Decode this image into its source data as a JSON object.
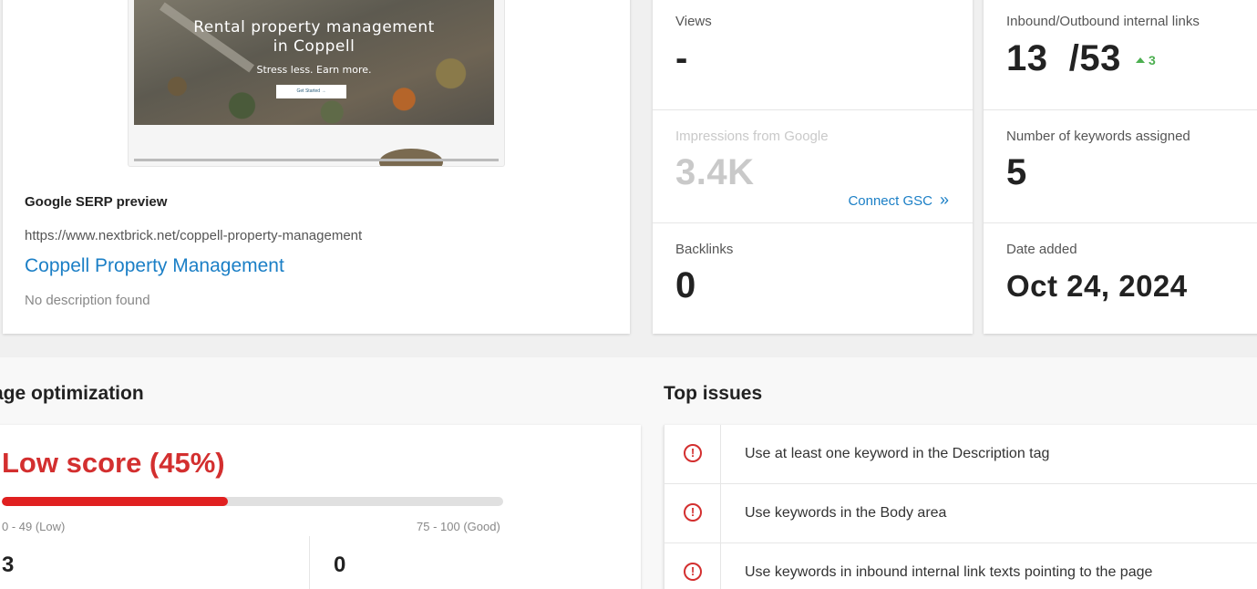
{
  "preview": {
    "thumbnail": {
      "headline": "Rental property management in Coppell",
      "tagline": "Stress less. Earn more.",
      "button_label": "Get Started →"
    },
    "serp_label": "Google SERP preview",
    "url": "https://www.nextbrick.net/coppell-property-management",
    "title": "Coppell Property Management",
    "description": "No description found"
  },
  "metrics": {
    "views": {
      "label": "Views",
      "value": "-"
    },
    "impressions": {
      "label": "Impressions from Google",
      "value": "3.4K",
      "connect_label": "Connect GSC",
      "connect_icon": "double-chevron-right-icon"
    },
    "backlinks": {
      "label": "Backlinks",
      "value": "0"
    },
    "internal_links": {
      "label": "Inbound/Outbound internal links",
      "value": "13  /53",
      "delta": "3",
      "delta_color": "#4caf50"
    },
    "keywords": {
      "label": "Number of keywords assigned",
      "value": "5"
    },
    "date_added": {
      "label": "Date added",
      "value": "Oct 24, 2024"
    }
  },
  "optimization": {
    "section_title": "age optimization",
    "score_label": "Low score (45%)",
    "score_percent": 45,
    "score_color": "#d32f2f",
    "range_low": "0 - 49 (Low)",
    "range_good": "75 - 100 (Good)",
    "count_left": "3",
    "count_right": "0"
  },
  "issues": {
    "section_title": "Top issues",
    "icon": "exclamation-circle-icon",
    "items": [
      "Use at least one keyword in the Description tag",
      "Use keywords in the Body area",
      "Use keywords in inbound internal link texts pointing to the page"
    ]
  }
}
